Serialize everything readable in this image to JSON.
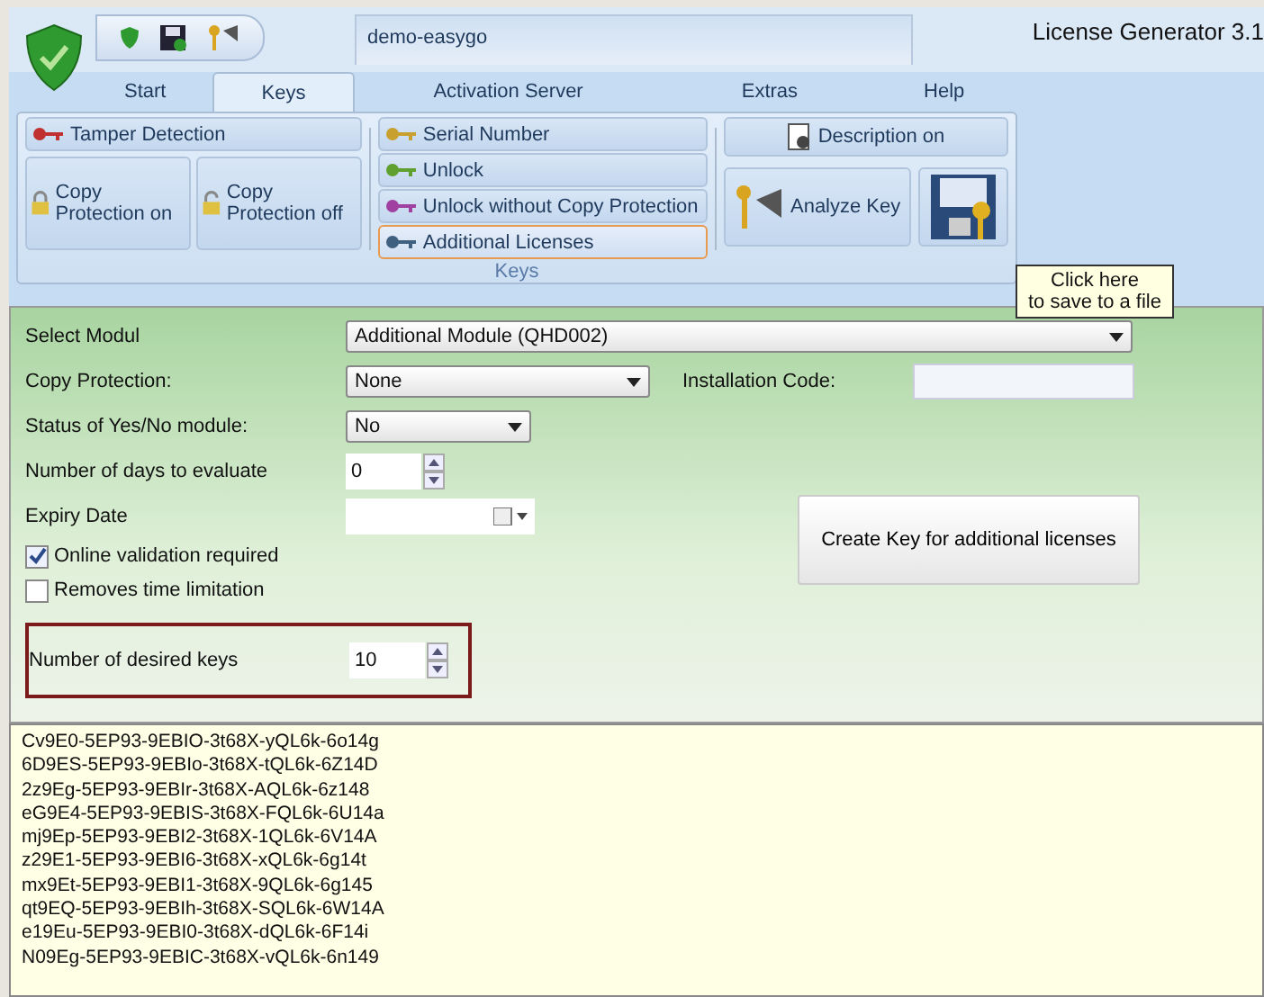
{
  "window": {
    "title": "License Generator 3.1",
    "document": "demo-easygo"
  },
  "tabs": [
    {
      "label": "Start",
      "selected": false
    },
    {
      "label": "Keys",
      "selected": true
    },
    {
      "label": "Activation Server",
      "selected": false
    },
    {
      "label": "Extras",
      "selected": false
    },
    {
      "label": "Help",
      "selected": false
    }
  ],
  "ribbon": {
    "group_label": "Keys",
    "tamper": {
      "label": "Tamper Detection"
    },
    "protection_buttons": [
      {
        "label": "Copy Protection on",
        "kind": "locked"
      },
      {
        "label": "Copy Protection off",
        "kind": "unlocked"
      }
    ],
    "key_buttons": [
      {
        "label": "Serial Number",
        "color": "#c8a030",
        "selected": false
      },
      {
        "label": "Unlock",
        "color": "#60a030",
        "selected": false
      },
      {
        "label": "Unlock without Copy Protection",
        "color": "#a040a0",
        "selected": false
      },
      {
        "label": "Additional Licenses",
        "color": "#406080",
        "selected": true
      }
    ],
    "description": {
      "label": "Description on"
    },
    "analyze": {
      "label": "Analyze Key"
    },
    "tooltip": {
      "lines": [
        "Click here",
        "to save to a file"
      ]
    }
  },
  "form": {
    "select_modul": {
      "label": "Select Modul",
      "value": "Additional Module (QHD002)"
    },
    "copy_protection": {
      "label": "Copy Protection:",
      "value": "None"
    },
    "installation_code": {
      "label": "Installation Code:"
    },
    "yes_no": {
      "label": "Status of Yes/No module:",
      "value": "No"
    },
    "days": {
      "label": "Number of days to evaluate",
      "value": "0"
    },
    "expiry": {
      "label": "Expiry Date"
    },
    "checkboxes": [
      {
        "label": "Online validation required",
        "checked": true
      },
      {
        "label": "Removes time limitation",
        "checked": false
      }
    ],
    "desired_keys": {
      "label": "Number of desired keys",
      "value": "10"
    },
    "create_button": "Create Key for additional licenses"
  },
  "output": [
    "Cv9E0-5EP93-9EBIO-3t68X-yQL6k-6o14g",
    "6D9ES-5EP93-9EBIo-3t68X-tQL6k-6Z14D",
    "2z9Eg-5EP93-9EBIr-3t68X-AQL6k-6z148",
    "eG9E4-5EP93-9EBIS-3t68X-FQL6k-6U14a",
    "mj9Ep-5EP93-9EBI2-3t68X-1QL6k-6V14A",
    "z29E1-5EP93-9EBI6-3t68X-xQL6k-6g14t",
    "mx9Et-5EP93-9EBI1-3t68X-9QL6k-6g145",
    "qt9EQ-5EP93-9EBIh-3t68X-SQL6k-6W14A",
    "e19Eu-5EP93-9EBI0-3t68X-dQL6k-6F14i",
    "N09Eg-5EP93-9EBIC-3t68X-vQL6k-6n149"
  ]
}
